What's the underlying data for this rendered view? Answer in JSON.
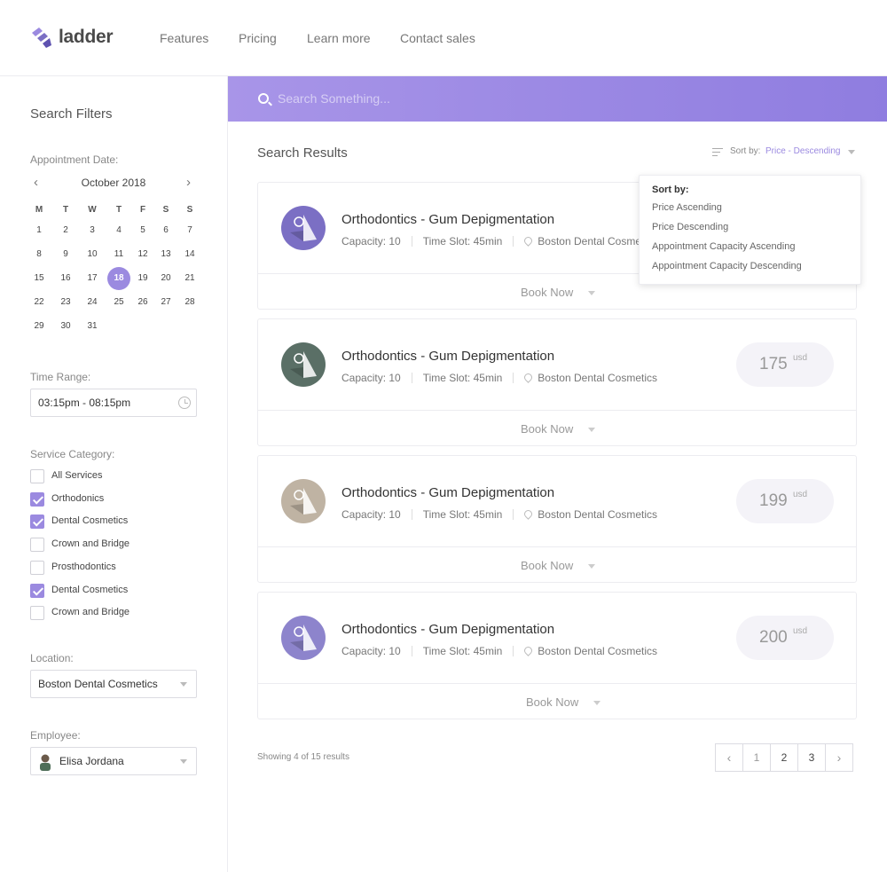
{
  "brand": {
    "name": "ladder",
    "accent": "#9b8ae0"
  },
  "nav": {
    "links": [
      "Features",
      "Pricing",
      "Learn more",
      "Contact sales"
    ]
  },
  "sidebar": {
    "title": "Search Filters",
    "date_label": "Appointment Date:",
    "calendar": {
      "month": "October 2018",
      "prev_icon": "chevron-left-icon",
      "next_icon": "chevron-right-icon",
      "weekdays": [
        "M",
        "T",
        "W",
        "T",
        "F",
        "S",
        "S"
      ],
      "days": [
        "1",
        "2",
        "3",
        "4",
        "5",
        "6",
        "7",
        "8",
        "9",
        "10",
        "11",
        "12",
        "13",
        "14",
        "15",
        "16",
        "17",
        "18",
        "19",
        "20",
        "21",
        "22",
        "23",
        "24",
        "25",
        "26",
        "27",
        "28",
        "29",
        "30",
        "31"
      ],
      "selected": "18"
    },
    "time_label": "Time Range:",
    "time_value": "03:15pm - 08:15pm",
    "category_label": "Service Category:",
    "categories": [
      {
        "label": "All Services",
        "checked": false
      },
      {
        "label": "Orthodonics",
        "checked": true
      },
      {
        "label": "Dental Cosmetics",
        "checked": true
      },
      {
        "label": "Crown and Bridge",
        "checked": false
      },
      {
        "label": "Prosthodontics",
        "checked": false
      },
      {
        "label": "Dental Cosmetics",
        "checked": true
      },
      {
        "label": "Crown and Bridge",
        "checked": false
      }
    ],
    "location_label": "Location:",
    "location_value": "Boston Dental Cosmetics",
    "employee_label": "Employee:",
    "employee_value": "Elisa Jordana"
  },
  "search": {
    "placeholder": "Search Something..."
  },
  "results": {
    "title": "Search Results",
    "sort_label": "Sort by:",
    "sort_value": "Price - Descending",
    "sort_menu": {
      "heading": "Sort by:",
      "options": [
        "Price Ascending",
        "Price Descending",
        "Appointment Capacity Ascending",
        "Appointment Capacity Descending"
      ]
    },
    "cards": [
      {
        "title": "Orthodontics - Gum Depigmentation",
        "capacity": "Capacity: 10",
        "slot": "Time Slot: 45min",
        "location": "Boston Dental Cosmetics",
        "price": "",
        "unit": "",
        "book": "Book Now",
        "avatar_color": "#7b6fc4"
      },
      {
        "title": "Orthodontics - Gum Depigmentation",
        "capacity": "Capacity: 10",
        "slot": "Time Slot: 45min",
        "location": "Boston Dental Cosmetics",
        "price": "175",
        "unit": "usd",
        "book": "Book Now",
        "avatar_color": "#5a6f66"
      },
      {
        "title": "Orthodontics - Gum Depigmentation",
        "capacity": "Capacity: 10",
        "slot": "Time Slot: 45min",
        "location": "Boston Dental Cosmetics",
        "price": "199",
        "unit": "usd",
        "book": "Book Now",
        "avatar_color": "#bfb3a3"
      },
      {
        "title": "Orthodontics - Gum Depigmentation",
        "capacity": "Capacity: 10",
        "slot": "Time Slot: 45min",
        "location": "Boston Dental Cosmetics",
        "price": "200",
        "unit": "usd",
        "book": "Book Now",
        "avatar_color": "#8d84cc"
      }
    ],
    "showing": "Showing 4 of 15 results",
    "pages": [
      "1",
      "2",
      "3"
    ],
    "current_page": "1"
  }
}
